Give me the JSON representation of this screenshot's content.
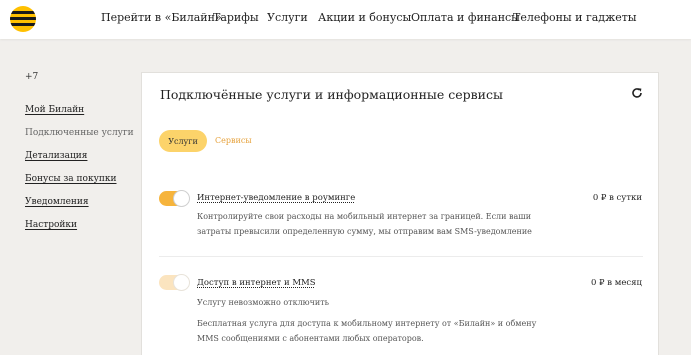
{
  "header": {
    "nav": [
      "Перейти в «Билайн»",
      "Тарифы",
      "Услуги",
      "Акции и бонусы",
      "Оплата и финансы",
      "Телефоны и гаджеты"
    ]
  },
  "sidebar": {
    "phone": "+7",
    "items": [
      {
        "label": "Мой Билайн",
        "active": false
      },
      {
        "label": "Подключенные услуги",
        "active": true
      },
      {
        "label": "Детализация",
        "active": false
      },
      {
        "label": "Бонусы за покупки",
        "active": false
      },
      {
        "label": "Уведомления",
        "active": false
      },
      {
        "label": "Настройки",
        "active": false
      }
    ]
  },
  "main": {
    "title": "Подключённые услуги и информационные сервисы",
    "tabs": [
      {
        "label": "Услуги",
        "active": true
      },
      {
        "label": "Сервисы",
        "active": false
      }
    ],
    "services": [
      {
        "name": "Интернет-уведомление в роуминге",
        "price": "0 ₽ в сутки",
        "enabled": true,
        "locked_note": "",
        "description": "Контролируйте свои расходы на мобильный интернет за границей. Если ваши затраты превысили определенную сумму, мы отправим вам SMS-уведомление"
      },
      {
        "name": "Доступ в интернет и MMS",
        "price": "0 ₽ в месяц",
        "enabled": true,
        "locked_note": "Услугу невозможно отключить",
        "description": "Бесплатная услуга для доступа к мобильному интернету от «Билайн» и обмену MMS сообщениями с абонентами любых операторов."
      }
    ]
  },
  "colors": {
    "accent": "#fcd36a",
    "toggle_on": "#f6b43c",
    "toggle_locked": "#fbe4bf",
    "tab_link": "#e6a23c",
    "background": "#f1efec"
  },
  "icons": {
    "logo": "beeline-logo-icon",
    "refresh": "refresh-icon"
  }
}
